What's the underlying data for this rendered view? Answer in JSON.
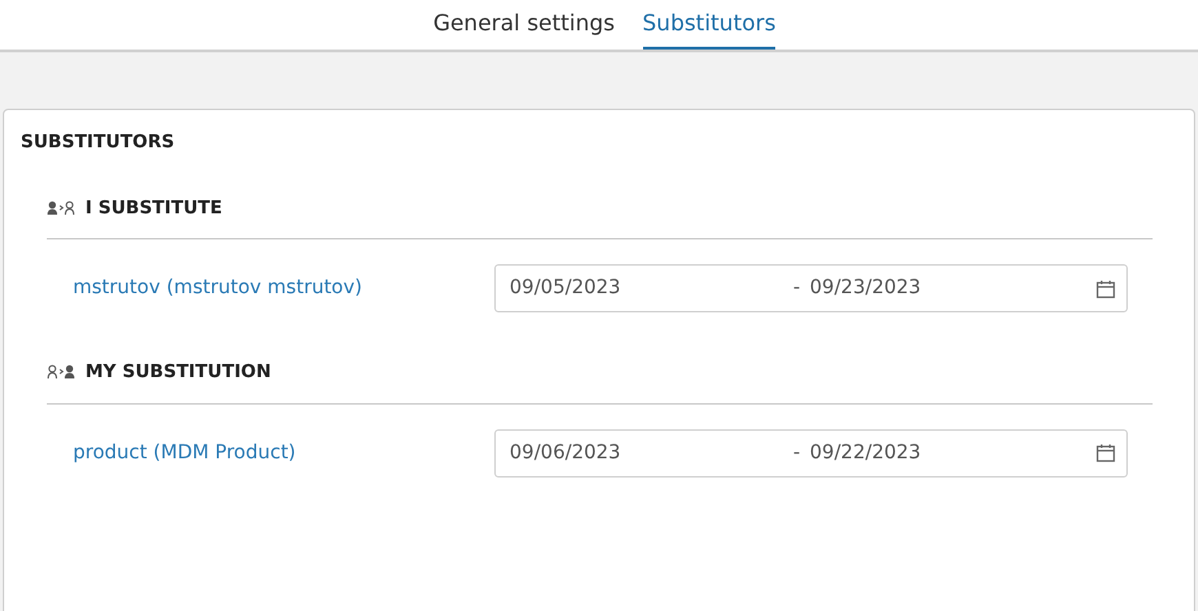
{
  "tabs": [
    {
      "label": "General settings",
      "selected": false
    },
    {
      "label": "Substitutors",
      "selected": true
    }
  ],
  "panel": {
    "title": "SUBSTITUTORS",
    "sections": [
      {
        "kind": "i_substitute",
        "title": "I SUBSTITUTE",
        "rows": [
          {
            "user": "mstrutov (mstrutov mstrutov)",
            "from": "09/05/2023",
            "separator": "-",
            "to": "09/23/2023"
          }
        ]
      },
      {
        "kind": "my_substitution",
        "title": "MY SUBSTITUTION",
        "rows": [
          {
            "user": "product (MDM Product)",
            "from": "09/06/2023",
            "separator": "-",
            "to": "09/22/2023"
          }
        ]
      }
    ]
  }
}
